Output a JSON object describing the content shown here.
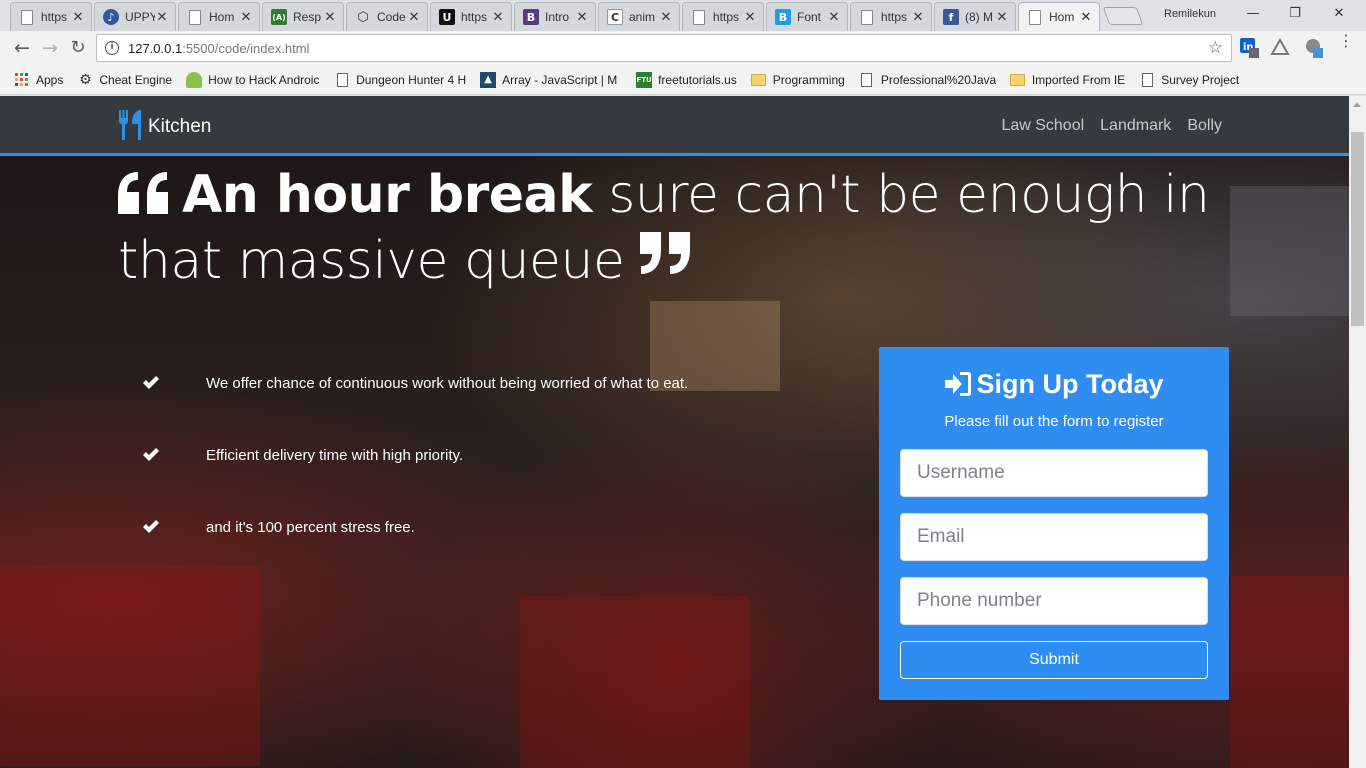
{
  "browser": {
    "tabs": [
      {
        "title": "https",
        "favicon": "page-icon"
      },
      {
        "title": "UPPY",
        "favicon": "uppy-icon"
      },
      {
        "title": "Hom",
        "favicon": "page-icon"
      },
      {
        "title": "Resp",
        "favicon": "android-icon"
      },
      {
        "title": "Code",
        "favicon": "codepen-icon"
      },
      {
        "title": "https",
        "favicon": "udemy-icon"
      },
      {
        "title": "Intro",
        "favicon": "bootstrap-icon"
      },
      {
        "title": "anim",
        "favicon": "c-icon"
      },
      {
        "title": "https",
        "favicon": "page-icon"
      },
      {
        "title": "Font",
        "favicon": "b-icon"
      },
      {
        "title": "https",
        "favicon": "page-icon"
      },
      {
        "title": "(8) M",
        "favicon": "facebook-icon"
      },
      {
        "title": "Hom",
        "favicon": "page-icon",
        "active": true
      }
    ],
    "tab_close_glyph": "✕",
    "profile_name": "Remilekun",
    "window_controls": {
      "minimize": "—",
      "restore": "❐",
      "close": "✕"
    },
    "url": "127.0.0.1:5500/code/index.html",
    "url_host": "127.0.0.1",
    "url_rest": ":5500/code/index.html",
    "bookmarks": [
      {
        "label": "Apps",
        "icon": "apps-grid-icon"
      },
      {
        "label": "Cheat Engine",
        "icon": "cheat-engine-icon"
      },
      {
        "label": "How to Hack Androic",
        "icon": "android-head-icon"
      },
      {
        "label": "Dungeon Hunter 4 H",
        "icon": "page-icon"
      },
      {
        "label": "Array - JavaScript | M",
        "icon": "mdn-icon"
      },
      {
        "label": "freetutorials.us",
        "icon": "ftu-icon"
      },
      {
        "label": "Programming",
        "icon": "folder-icon"
      },
      {
        "label": "Professional%20Java",
        "icon": "page-icon"
      },
      {
        "label": "Imported From IE",
        "icon": "folder-icon"
      },
      {
        "label": "Survey Project",
        "icon": "page-icon"
      }
    ],
    "colors": {
      "facebook": "#3b5998",
      "bootstrap": "#563d7c",
      "accent": "#2f8cf0"
    }
  },
  "site": {
    "brand": "Kitchen",
    "nav_links": [
      "Law School",
      "Landmark",
      "Bolly"
    ],
    "headline": {
      "strong": "An hour break",
      "rest": " sure can't be enough in that massive queue"
    },
    "features": [
      "We offer chance of continuous work without being worried of what to eat.",
      "Efficient delivery time with high priority.",
      "and it's 100 percent stress free."
    ],
    "signup": {
      "title": "Sign Up Today",
      "subtitle": "Please fill out the form to register",
      "fields": {
        "username_placeholder": "Username",
        "email_placeholder": "Email",
        "phone_placeholder": "Phone number"
      },
      "submit_label": "Submit"
    },
    "colors": {
      "nav_bg": "#343a40",
      "nav_border": "#2f8fe0",
      "card_bg": "#2f8cf0"
    }
  }
}
